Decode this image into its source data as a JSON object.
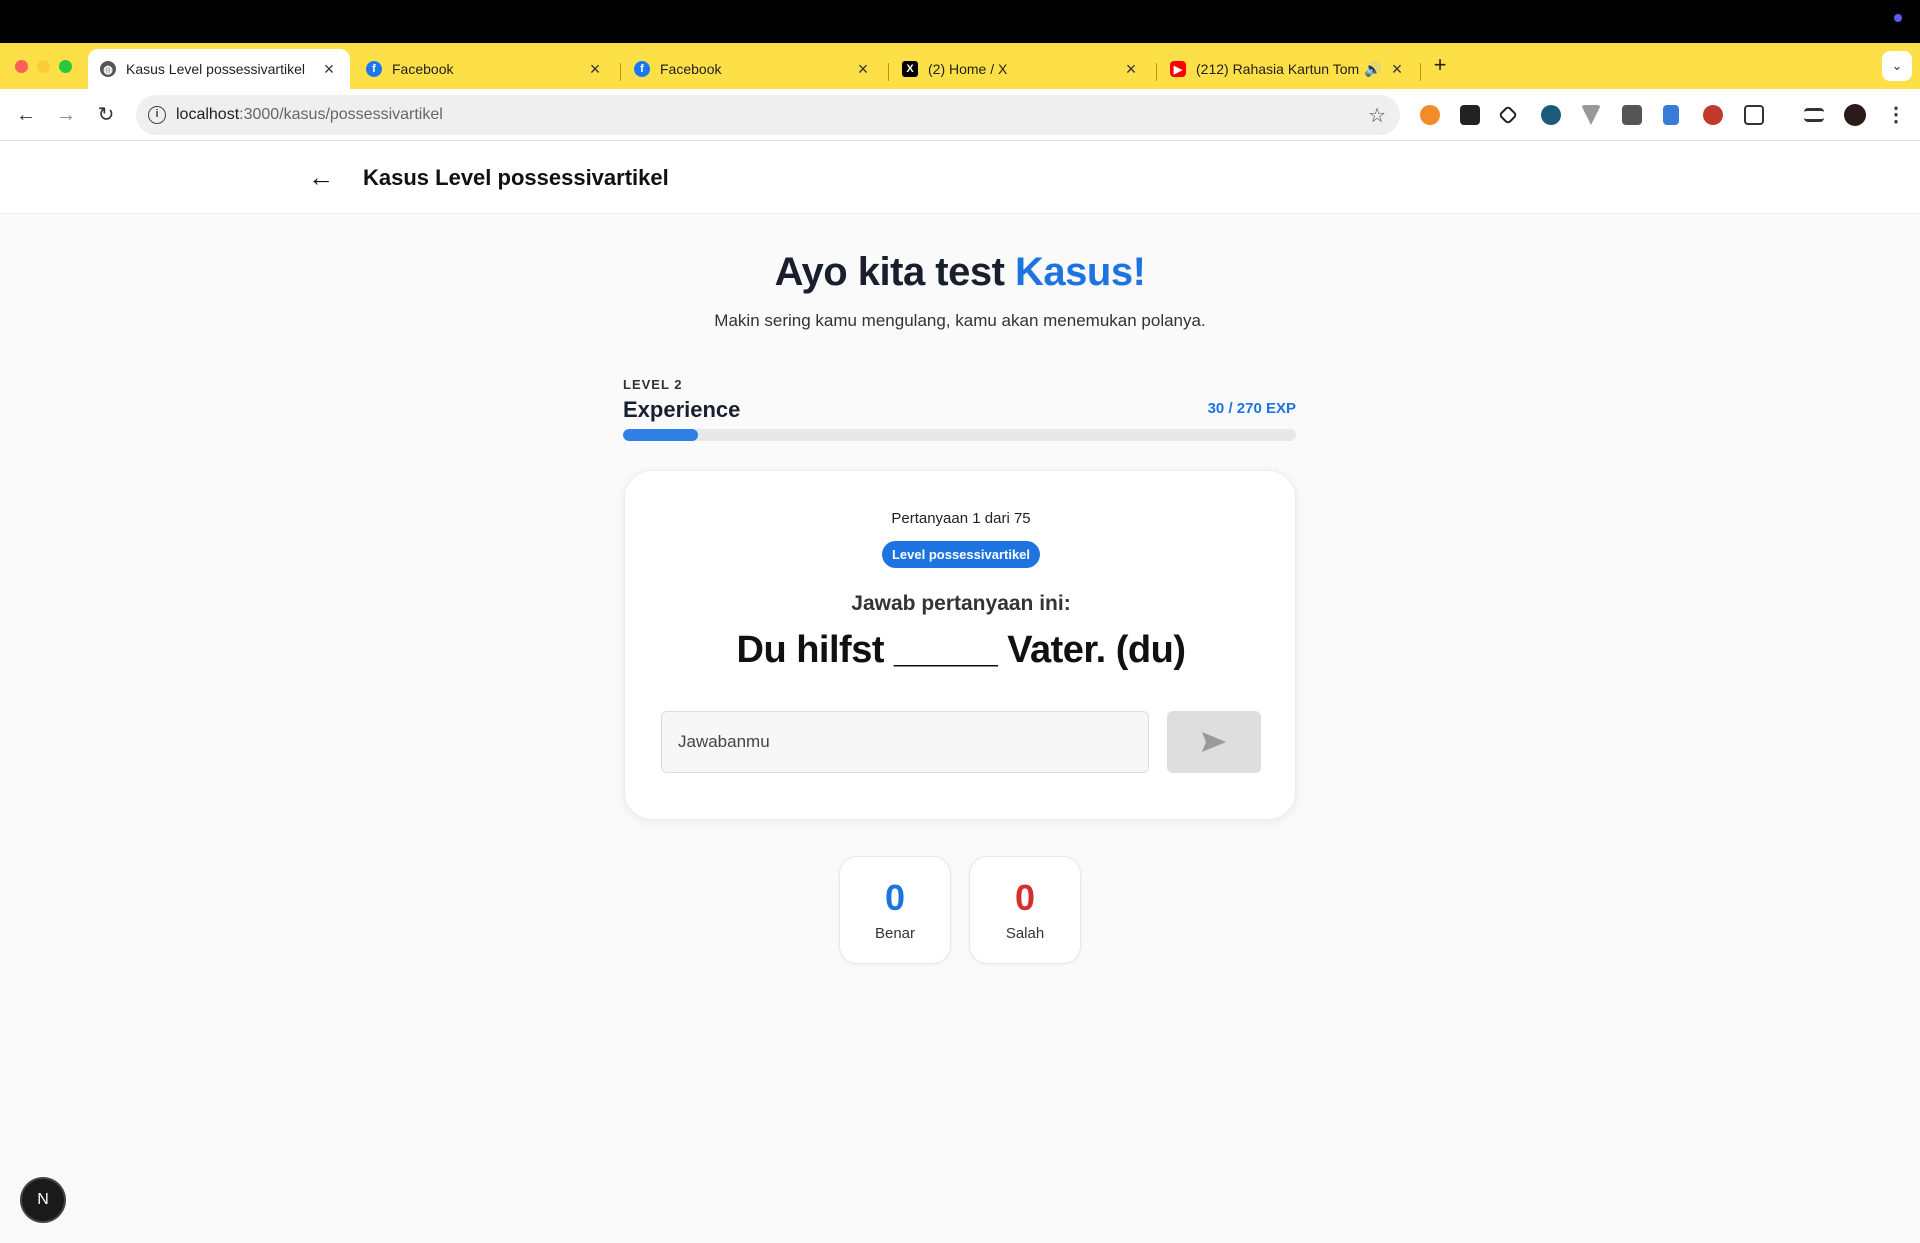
{
  "browser": {
    "tabs": [
      {
        "title": "Kasus Level possessivartikel",
        "active": true,
        "icon": "globe-icon",
        "color": "#444444"
      },
      {
        "title": "Facebook",
        "active": false,
        "icon": "facebook-icon",
        "color": "#1877f2"
      },
      {
        "title": "Facebook",
        "active": false,
        "icon": "facebook-icon",
        "color": "#1877f2"
      },
      {
        "title": "(2) Home / X",
        "active": false,
        "icon": "x-icon",
        "color": "#000000"
      },
      {
        "title": "(212) Rahasia Kartun Tom",
        "active": false,
        "icon": "youtube-icon",
        "color": "#ff0000",
        "audio": true
      }
    ],
    "url_host": "localhost",
    "url_path": ":3000/kasus/possessivartikel",
    "tabstrip_color": "#fde047"
  },
  "header": {
    "title": "Kasus Level possessivartikel"
  },
  "hero": {
    "title_main": "Ayo kita test ",
    "title_accent": "Kasus!",
    "subtitle": "Makin sering kamu mengulang, kamu akan menemukan polanya."
  },
  "level": {
    "label": "LEVEL 2",
    "name": "Experience",
    "exp_text": "30 / 270 EXP",
    "exp_current": 30,
    "exp_max": 270
  },
  "quiz": {
    "counter": "Pertanyaan 1 dari 75",
    "badge": "Level possessivartikel",
    "prompt": "Jawab pertanyaan ini:",
    "question": "Du hilfst _____ Vater. (du)",
    "input_placeholder": "Jawabanmu",
    "input_value": ""
  },
  "score": {
    "correct_value": "0",
    "correct_label": "Benar",
    "wrong_value": "0",
    "wrong_label": "Salah"
  },
  "misc": {
    "dev_badge": "N"
  }
}
